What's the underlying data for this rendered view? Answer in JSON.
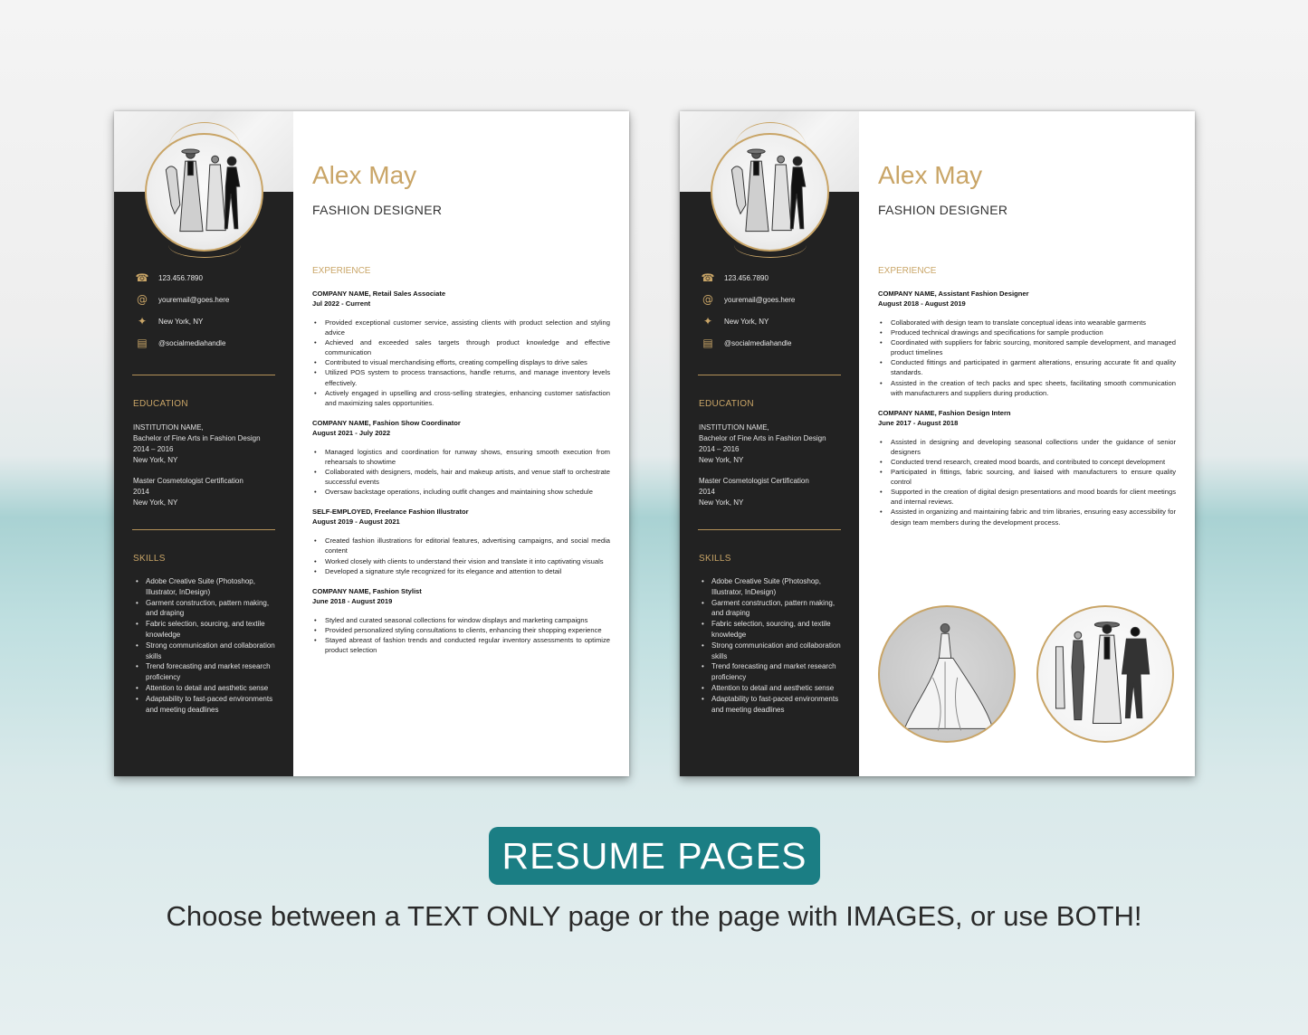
{
  "banner": {
    "label": "RESUME PAGES"
  },
  "tagline": "Choose between a TEXT ONLY page or the page with IMAGES, or use BOTH!",
  "colors": {
    "gold": "#c9a567",
    "sidebar": "#222222",
    "banner": "#1b7e84"
  },
  "pages": [
    {
      "variant": "text-only",
      "name": "Alex May",
      "title": "FASHION DESIGNER",
      "contact": [
        {
          "icon": "phone-icon",
          "glyph": "☎",
          "text": "123.456.7890"
        },
        {
          "icon": "at-sign-icon",
          "glyph": "@",
          "text": "youremail@goes.here"
        },
        {
          "icon": "pushpin-icon",
          "glyph": "✦",
          "text": "New York, NY"
        },
        {
          "icon": "message-icon",
          "glyph": "▤",
          "text": "@socialmediahandle"
        }
      ],
      "education_heading": "EDUCATION",
      "education": [
        {
          "lines": [
            "INSTITUTION NAME,",
            "Bachelor of Fine Arts in Fashion Design",
            "2014 – 2016",
            "New York, NY"
          ]
        },
        {
          "lines": [
            "Master Cosmetologist Certification",
            "2014",
            "New York, NY"
          ]
        }
      ],
      "skills_heading": "SKILLS",
      "skills": [
        "Adobe Creative Suite (Photoshop, Illustrator, InDesign)",
        "Garment construction, pattern making, and draping",
        "Fabric selection, sourcing, and textile knowledge",
        "Strong communication and collaboration skills",
        "Trend forecasting and market research proficiency",
        "Attention to detail and aesthetic sense",
        "Adaptability to fast-paced environments and meeting deadlines"
      ],
      "experience_heading": "EXPERIENCE",
      "experience": [
        {
          "role": "COMPANY NAME, Retail Sales Associate",
          "dates": "Jul 2022 - Current",
          "bullets": [
            "Provided exceptional customer service, assisting clients with product selection and styling advice",
            "Achieved and exceeded sales targets through product knowledge and effective communication",
            "Contributed to visual merchandising efforts, creating compelling displays to drive sales",
            "Utilized POS system to process transactions, handle returns, and manage inventory levels effectively.",
            "Actively engaged in upselling and cross-selling strategies, enhancing customer satisfaction and maximizing sales opportunities."
          ]
        },
        {
          "role": "COMPANY NAME, Fashion Show Coordinator",
          "dates": "August 2021 - July 2022",
          "bullets": [
            "Managed logistics and coordination for runway shows, ensuring smooth execution from rehearsals to showtime",
            "Collaborated with designers, models, hair and makeup artists, and venue staff to orchestrate successful events",
            "Oversaw backstage operations, including outfit changes and maintaining show schedule"
          ]
        },
        {
          "role": "SELF-EMPLOYED, Freelance Fashion Illustrator",
          "dates": "August 2019 - August 2021",
          "bullets": [
            "Created fashion illustrations for editorial features, advertising campaigns, and social media content",
            "Worked closely with clients to understand their vision and translate it into captivating visuals",
            "Developed a signature style recognized for its elegance and attention to detail"
          ]
        },
        {
          "role": "COMPANY NAME, Fashion Stylist",
          "dates": "June 2018 - August 2019",
          "bullets": [
            "Styled and curated seasonal collections for window displays and marketing campaigns",
            "Provided personalized styling consultations to clients, enhancing their shopping experience",
            "Stayed abreast of fashion trends and conducted regular inventory assessments to optimize product selection"
          ]
        }
      ]
    },
    {
      "variant": "with-images",
      "name": "Alex May",
      "title": "FASHION DESIGNER",
      "contact": [
        {
          "icon": "phone-icon",
          "glyph": "☎",
          "text": "123.456.7890"
        },
        {
          "icon": "at-sign-icon",
          "glyph": "@",
          "text": "youremail@goes.here"
        },
        {
          "icon": "pushpin-icon",
          "glyph": "✦",
          "text": "New York, NY"
        },
        {
          "icon": "message-icon",
          "glyph": "▤",
          "text": "@socialmediahandle"
        }
      ],
      "education_heading": "EDUCATION",
      "education": [
        {
          "lines": [
            "INSTITUTION NAME,",
            "Bachelor of Fine Arts in Fashion Design",
            "2014 – 2016",
            "New York, NY"
          ]
        },
        {
          "lines": [
            "Master Cosmetologist Certification",
            "2014",
            "New York, NY"
          ]
        }
      ],
      "skills_heading": "SKILLS",
      "skills": [
        "Adobe Creative Suite (Photoshop, Illustrator, InDesign)",
        "Garment construction, pattern making, and draping",
        "Fabric selection, sourcing, and textile knowledge",
        "Strong communication and collaboration skills",
        "Trend forecasting and market research proficiency",
        "Attention to detail and aesthetic sense",
        "Adaptability to fast-paced environments and meeting deadlines"
      ],
      "experience_heading": "EXPERIENCE",
      "experience": [
        {
          "role": "COMPANY NAME, Assistant Fashion Designer",
          "dates": "August 2018 - August 2019",
          "bullets": [
            "Collaborated with design team to translate conceptual ideas into wearable garments",
            "Produced technical drawings and specifications for sample production",
            "Coordinated with suppliers for fabric sourcing, monitored sample development, and managed product timelines",
            "Conducted fittings and participated in garment alterations, ensuring accurate fit and quality standards.",
            "Assisted in the creation of tech packs and spec sheets, facilitating smooth communication with manufacturers and suppliers during production."
          ]
        },
        {
          "role": "COMPANY NAME, Fashion Design Intern",
          "dates": "June 2017 - August 2018",
          "bullets": [
            "Assisted in designing and developing seasonal collections under the guidance of senior designers",
            "Conducted trend research, created mood boards, and contributed to concept development",
            "Participated in fittings, fabric sourcing, and liaised with manufacturers to ensure quality control",
            "Supported in the creation of digital design presentations and mood boards for client meetings and internal reviews.",
            "Assisted in organizing and maintaining fabric and trim libraries, ensuring easy accessibility for design team members during the development process."
          ]
        }
      ],
      "images": [
        {
          "name": "gown-sketch",
          "alt": "fashion sketch of model in flowing gown"
        },
        {
          "name": "runway-sketch",
          "alt": "fashion sketch of models on runway"
        }
      ]
    }
  ]
}
